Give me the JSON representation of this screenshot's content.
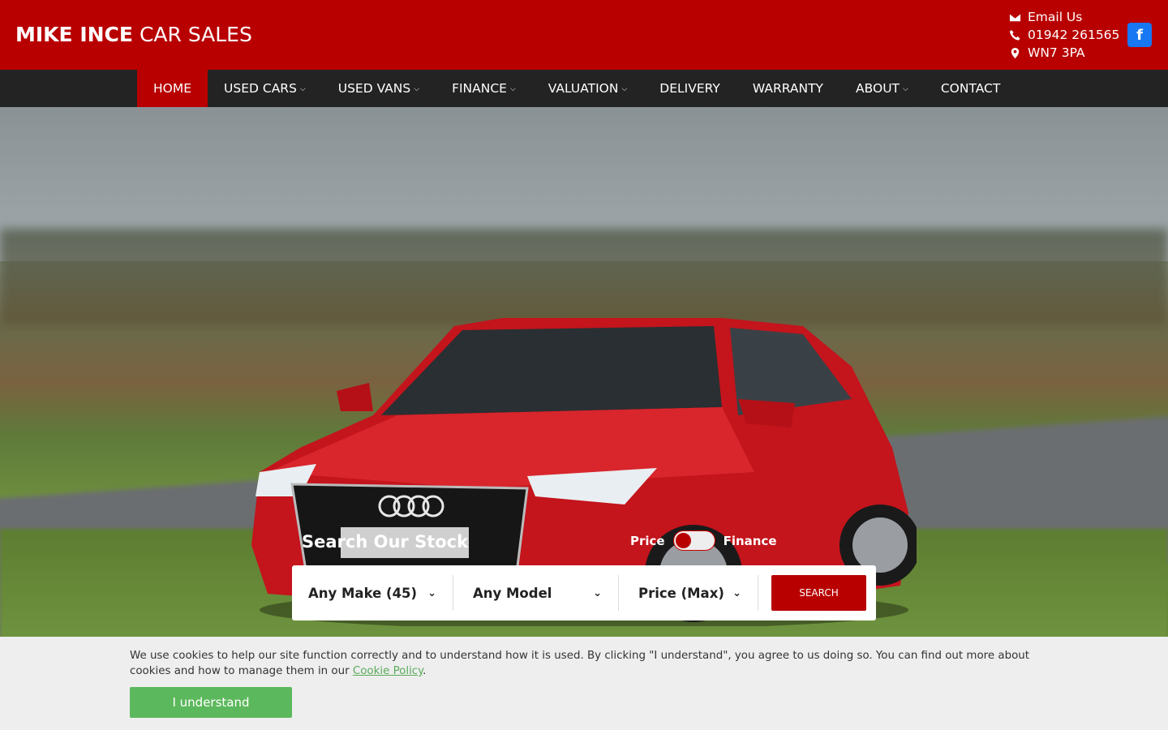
{
  "header": {
    "logo_bold": "MIKE INCE",
    "logo_light": "CAR SALES",
    "email_label": "Email Us",
    "phone": "01942 261565",
    "postcode": "WN7 3PA",
    "facebook_glyph": "f"
  },
  "nav": {
    "items": [
      {
        "label": "HOME"
      },
      {
        "label": "USED CARS"
      },
      {
        "label": "USED VANS"
      },
      {
        "label": "FINANCE"
      },
      {
        "label": "VALUATION"
      },
      {
        "label": "DELIVERY"
      },
      {
        "label": "WARRANTY"
      },
      {
        "label": "ABOUT"
      },
      {
        "label": "CONTACT"
      }
    ]
  },
  "search": {
    "title": "Search Our Stock",
    "toggle_left": "Price",
    "toggle_right": "Finance",
    "make": "Any Make (45)",
    "model": "Any Model",
    "price": "Price (Max)",
    "button": "SEARCH"
  },
  "cookie": {
    "text": "We use cookies to help our site function correctly and to understand how it is used. By clicking \"I understand\", you agree to us doing so. You can find out more about cookies and how to manage them in our ",
    "link": "Cookie Policy",
    "suffix": ".",
    "button": "I understand"
  },
  "colors": {
    "brand_red": "#b80000",
    "nav_dark": "#232323",
    "accept_green": "#5cb85c",
    "facebook_blue": "#1877f2"
  }
}
